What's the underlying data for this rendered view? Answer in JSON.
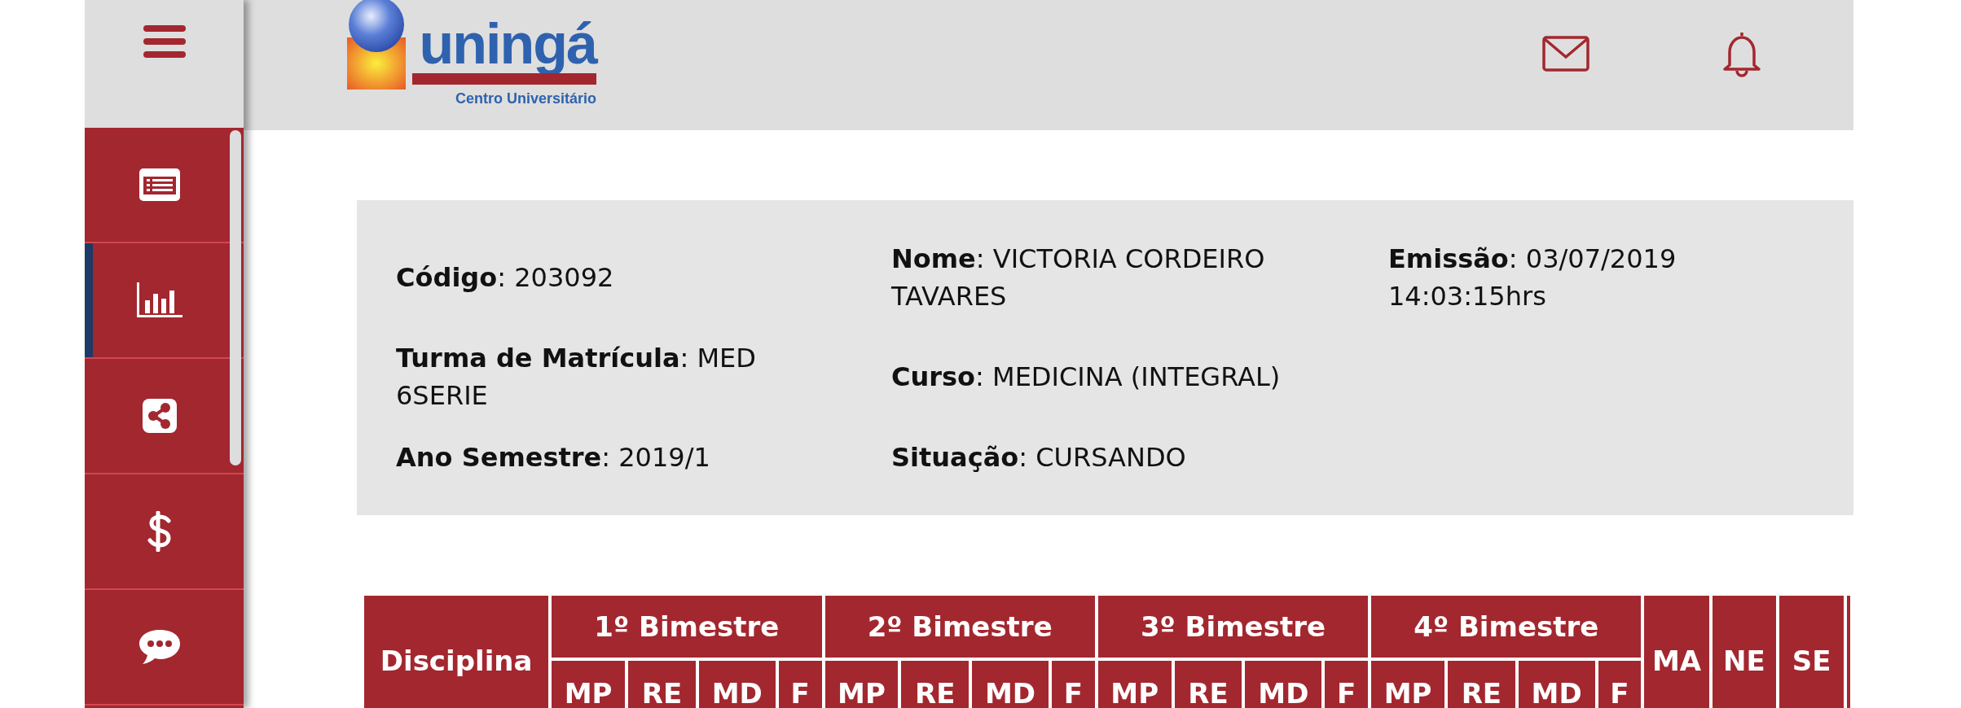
{
  "sidebar": {
    "items": [
      {
        "kind": "news",
        "selected": false
      },
      {
        "kind": "chart",
        "selected": true
      },
      {
        "kind": "share",
        "selected": false
      },
      {
        "kind": "money",
        "selected": false
      },
      {
        "kind": "chat",
        "selected": false
      }
    ]
  },
  "header": {
    "logo": {
      "name": "uningá",
      "tagline": "Centro Universitário"
    }
  },
  "info": {
    "rows": [
      [
        "**Código**: 203092",
        "**Nome**: VICTORIA CORDEIRO TAVARES",
        "**Emissão**: 03/07/2019 14:03:15hrs"
      ],
      [
        "**Turma de Matrícula**: MED 6SERIE",
        "**Curso**: MEDICINA (INTEGRAL)"
      ],
      [
        "**Ano Semestre**: 2019/1",
        "**Situação**: CURSANDO"
      ]
    ]
  },
  "table": {
    "first_column": "Disciplina",
    "groups": [
      {
        "label": "1º Bimestre",
        "subcolumns": [
          "MP",
          "RE",
          "MD",
          "F"
        ]
      },
      {
        "label": "2º Bimestre",
        "subcolumns": [
          "MP",
          "RE",
          "MD",
          "F"
        ]
      },
      {
        "label": "3º Bimestre",
        "subcolumns": [
          "MP",
          "RE",
          "MD",
          "F"
        ]
      },
      {
        "label": "4º Bimestre",
        "subcolumns": [
          "MP",
          "RE",
          "MD",
          "F"
        ]
      }
    ],
    "last_columns": [
      "MA",
      "NE",
      "SE"
    ]
  }
}
